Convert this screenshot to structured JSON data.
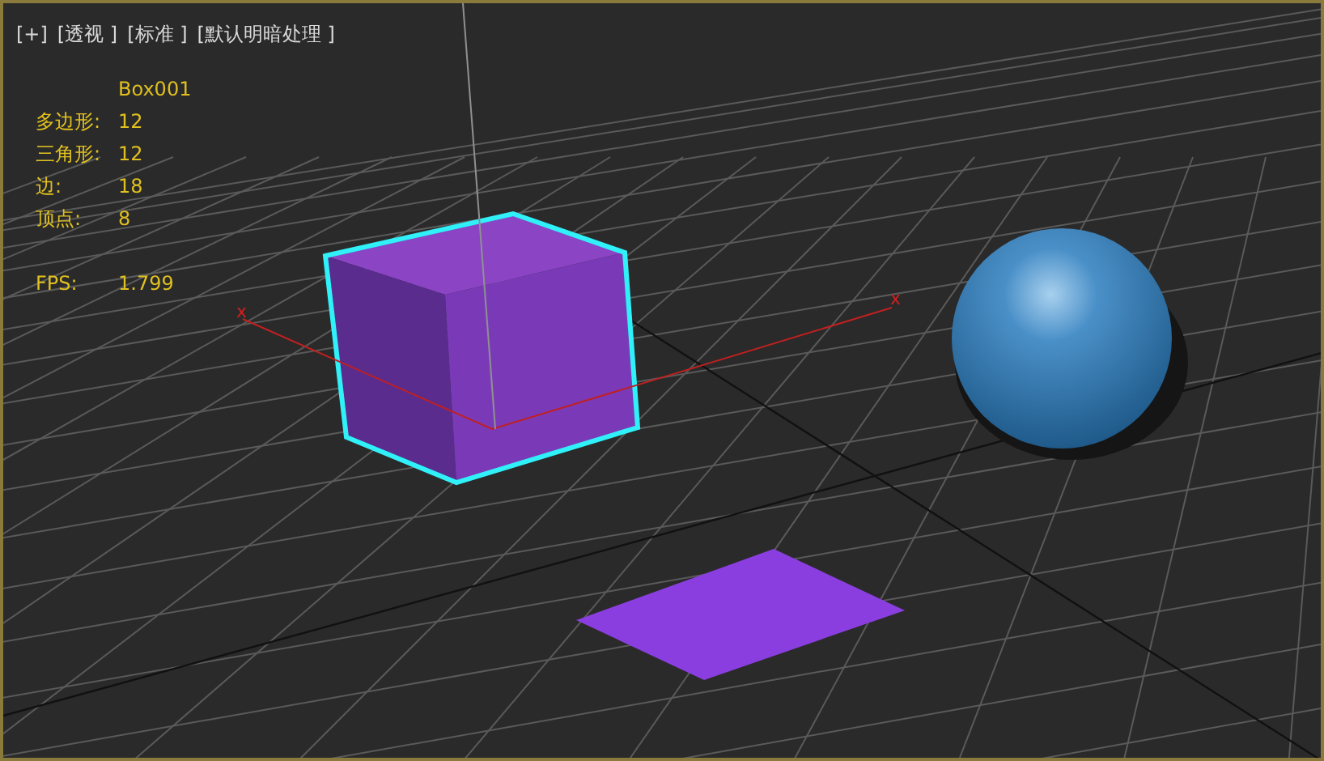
{
  "viewport_labels": [
    "[+]",
    "[透视 ]",
    "[标准 ]",
    "[默认明暗处理 ]"
  ],
  "stats": {
    "object_name": "Box001",
    "rows": [
      {
        "label": "多边形:",
        "value": "12"
      },
      {
        "label": "三角形:",
        "value": "12"
      },
      {
        "label": "边:",
        "value": "18"
      },
      {
        "label": "顶点:",
        "value": "8"
      }
    ],
    "fps": {
      "label": "FPS:",
      "value": "1.799"
    }
  },
  "axis_labels": [
    "x",
    "x"
  ]
}
